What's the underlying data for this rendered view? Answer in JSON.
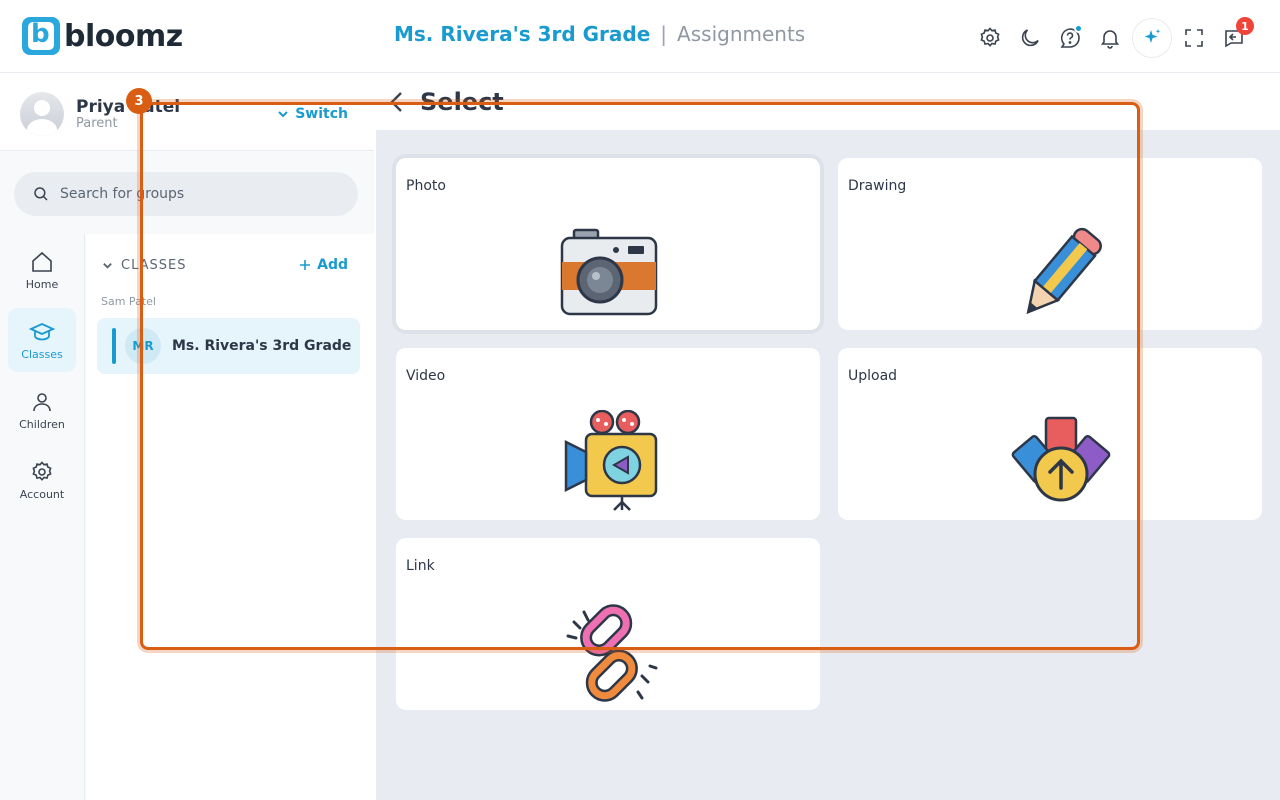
{
  "app": {
    "name": "bloomz"
  },
  "header": {
    "class_name": "Ms. Rivera's 3rd Grade",
    "separator": "|",
    "page_name": "Assignments",
    "notification_badge": "1"
  },
  "profile": {
    "name": "Priya Patel",
    "role": "Parent",
    "switch_label": "Switch"
  },
  "search": {
    "placeholder": "Search for groups"
  },
  "rail": {
    "items": [
      {
        "label": "Home",
        "icon": "home-icon"
      },
      {
        "label": "Classes",
        "icon": "graduation-cap-icon",
        "active": true
      },
      {
        "label": "Children",
        "icon": "person-icon"
      },
      {
        "label": "Account",
        "icon": "gear-icon"
      }
    ]
  },
  "classes": {
    "heading": "CLASSES",
    "add_label": "Add",
    "teacher": "Sam Patel",
    "items": [
      {
        "initials": "MR",
        "name": "Ms. Rivera's 3rd Grade"
      }
    ]
  },
  "main": {
    "title": "Select",
    "options": [
      {
        "label": "Photo",
        "icon": "camera-icon"
      },
      {
        "label": "Drawing",
        "icon": "pencil-icon"
      },
      {
        "label": "Video",
        "icon": "video-camera-icon"
      },
      {
        "label": "Upload",
        "icon": "upload-icon"
      },
      {
        "label": "Link",
        "icon": "link-icon"
      }
    ]
  },
  "overlay": {
    "step": "3"
  },
  "colors": {
    "accent": "#1a9bd0",
    "highlight": "#d95d12",
    "badge": "#f04438"
  }
}
